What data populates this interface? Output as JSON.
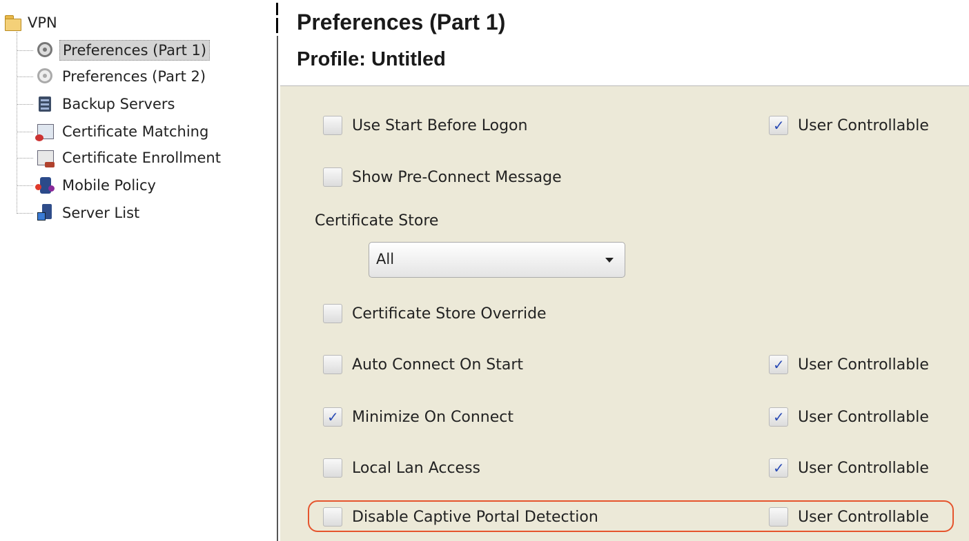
{
  "tree": {
    "root_label": "VPN",
    "items": [
      {
        "label": "Preferences (Part 1)",
        "icon": "gear-icon",
        "selected": true
      },
      {
        "label": "Preferences (Part 2)",
        "icon": "gear-faded-icon",
        "selected": false
      },
      {
        "label": "Backup Servers",
        "icon": "server-icon",
        "selected": false
      },
      {
        "label": "Certificate Matching",
        "icon": "certificate-icon",
        "selected": false
      },
      {
        "label": "Certificate Enrollment",
        "icon": "certificate-enroll-icon",
        "selected": false
      },
      {
        "label": "Mobile Policy",
        "icon": "mobile-policy-icon",
        "selected": false
      },
      {
        "label": "Server List",
        "icon": "server-list-icon",
        "selected": false
      }
    ]
  },
  "header": {
    "title": "Preferences (Part 1)",
    "profile": "Profile:  Untitled"
  },
  "form": {
    "use_start_before_logon": {
      "label": "Use Start Before Logon",
      "checked": false
    },
    "use_start_before_logon_uc": {
      "label": "User Controllable",
      "checked": true
    },
    "show_preconnect_message": {
      "label": "Show Pre-Connect Message",
      "checked": false
    },
    "certificate_store_label": "Certificate Store",
    "certificate_store_value": "All",
    "certificate_store_override": {
      "label": "Certificate Store Override",
      "checked": false
    },
    "auto_connect_on_start": {
      "label": "Auto Connect On Start",
      "checked": false
    },
    "auto_connect_on_start_uc": {
      "label": "User Controllable",
      "checked": true
    },
    "minimize_on_connect": {
      "label": "Minimize On Connect",
      "checked": true
    },
    "minimize_on_connect_uc": {
      "label": "User Controllable",
      "checked": true
    },
    "local_lan_access": {
      "label": "Local Lan Access",
      "checked": false
    },
    "local_lan_access_uc": {
      "label": "User Controllable",
      "checked": true
    },
    "disable_captive_portal": {
      "label": "Disable Captive Portal Detection",
      "checked": false
    },
    "disable_captive_portal_uc": {
      "label": "User Controllable",
      "checked": false
    }
  },
  "colors": {
    "panel_background": "#ece9d8",
    "highlight_outline": "#e5542d",
    "check_mark": "#2a4bb5"
  }
}
